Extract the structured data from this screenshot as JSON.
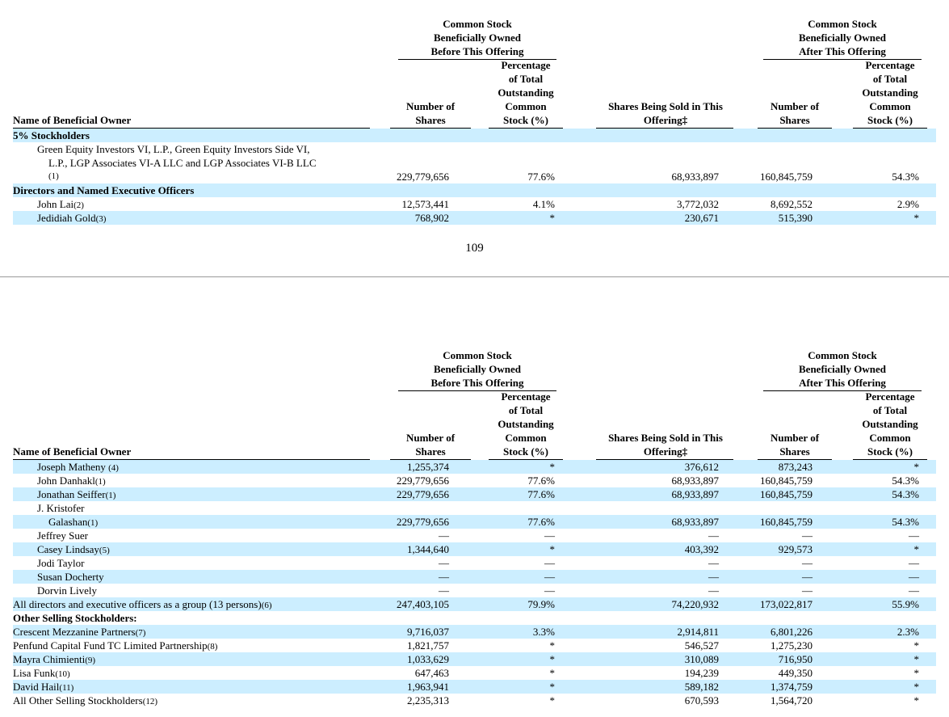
{
  "headers": {
    "name_col": "Name of Beneficial Owner",
    "before_group": [
      "Common Stock",
      "Beneficially Owned",
      "Before This Offering"
    ],
    "after_group": [
      "Common Stock",
      "Beneficially Owned",
      "After This Offering"
    ],
    "number_of_shares": [
      "Number of",
      "Shares"
    ],
    "percentage": [
      "Percentage",
      "of Total",
      "Outstanding",
      "Common",
      "Stock (%)"
    ],
    "shares_sold": [
      "Shares Being Sold in This",
      "Offering‡"
    ]
  },
  "page_number": "109",
  "table1": {
    "rows": [
      {
        "type": "section",
        "name": "5% Stockholders"
      },
      {
        "type": "multi",
        "lines": [
          "Green Equity Investors VI, L.P., Green Equity Investors Side VI,",
          "L.P., LGP Associates VI-A LLC and LGP Associates VI-B LLC",
          "(1)"
        ],
        "b_num": "229,779,656",
        "b_pct": "77.6%",
        "sold": "68,933,897",
        "a_num": "160,845,759",
        "a_pct": "54.3%"
      },
      {
        "type": "section",
        "name": "Directors and Named Executive Officers"
      },
      {
        "type": "data",
        "name": "John Lai",
        "note": "(2)",
        "b_num": "12,573,441",
        "b_pct": "4.1%",
        "sold": "3,772,032",
        "a_num": "8,692,552",
        "a_pct": "2.9%"
      },
      {
        "type": "data",
        "name": "Jedidiah Gold",
        "note": "(3)",
        "b_num": "768,902",
        "b_pct": "*",
        "sold": "230,671",
        "a_num": "515,390",
        "a_pct": "*"
      }
    ]
  },
  "table2": {
    "rows": [
      {
        "name": "Joseph Matheny ",
        "note": "(4)",
        "b_num": "1,255,374",
        "b_pct": "*",
        "sold": "376,612",
        "a_num": "873,243",
        "a_pct": "*"
      },
      {
        "name": "John Danhakl",
        "note": "(1)",
        "b_num": "229,779,656",
        "b_pct": "77.6%",
        "sold": "68,933,897",
        "a_num": "160,845,759",
        "a_pct": "54.3%"
      },
      {
        "name": "Jonathan Seiffer",
        "note": "(1)",
        "b_num": "229,779,656",
        "b_pct": "77.6%",
        "sold": "68,933,897",
        "a_num": "160,845,759",
        "a_pct": "54.3%"
      },
      {
        "name": "J. Kristofer",
        "note": "",
        "b_num": "",
        "b_pct": "",
        "sold": "",
        "a_num": "",
        "a_pct": ""
      },
      {
        "name": "Galashan",
        "note": "(1)",
        "b_num": "229,779,656",
        "b_pct": "77.6%",
        "sold": "68,933,897",
        "a_num": "160,845,759",
        "a_pct": "54.3%"
      },
      {
        "name": "Jeffrey Suer",
        "note": "",
        "b_num": "—",
        "b_pct": "—",
        "sold": "—",
        "a_num": "—",
        "a_pct": "—"
      },
      {
        "name": "Casey Lindsay",
        "note": "(5)",
        "b_num": "1,344,640",
        "b_pct": "*",
        "sold": "403,392",
        "a_num": "929,573",
        "a_pct": "*"
      },
      {
        "name": "Jodi Taylor",
        "note": "",
        "b_num": "—",
        "b_pct": "—",
        "sold": "—",
        "a_num": "—",
        "a_pct": "—"
      },
      {
        "name": "Susan Docherty",
        "note": "",
        "b_num": "—",
        "b_pct": "—",
        "sold": "—",
        "a_num": "—",
        "a_pct": "—"
      },
      {
        "name": "Dorvin Lively",
        "note": "",
        "b_num": "—",
        "b_pct": "—",
        "sold": "—",
        "a_num": "—",
        "a_pct": "—"
      },
      {
        "name": "All directors and executive officers as a group (13 persons)",
        "note": "(6)",
        "b_num": "247,403,105",
        "b_pct": "79.9%",
        "sold": "74,220,932",
        "a_num": "173,022,817",
        "a_pct": "55.9%"
      },
      {
        "name": "Other Selling Stockholders:",
        "note": "",
        "b_num": "",
        "b_pct": "",
        "sold": "",
        "a_num": "",
        "a_pct": ""
      },
      {
        "name": "Crescent Mezzanine Partners",
        "note": "(7)",
        "b_num": "9,716,037",
        "b_pct": "3.3%",
        "sold": "2,914,811",
        "a_num": "6,801,226",
        "a_pct": "2.3%"
      },
      {
        "name": "Penfund Capital Fund TC Limited Partnership",
        "note": "(8)",
        "b_num": "1,821,757",
        "b_pct": "*",
        "sold": "546,527",
        "a_num": "1,275,230",
        "a_pct": "*"
      },
      {
        "name": "Mayra Chimienti",
        "note": "(9)",
        "b_num": "1,033,629",
        "b_pct": "*",
        "sold": "310,089",
        "a_num": "716,950",
        "a_pct": "*"
      },
      {
        "name": "Lisa Funk",
        "note": "(10)",
        "b_num": "647,463",
        "b_pct": "*",
        "sold": "194,239",
        "a_num": "449,350",
        "a_pct": "*"
      },
      {
        "name": "David Hail",
        "note": "(11)",
        "b_num": "1,963,941",
        "b_pct": "*",
        "sold": "589,182",
        "a_num": "1,374,759",
        "a_pct": "*"
      },
      {
        "name": "All Other Selling Stockholders",
        "note": "(12)",
        "b_num": "2,235,313",
        "b_pct": "*",
        "sold": "670,593",
        "a_num": "1,564,720",
        "a_pct": "*"
      }
    ]
  }
}
